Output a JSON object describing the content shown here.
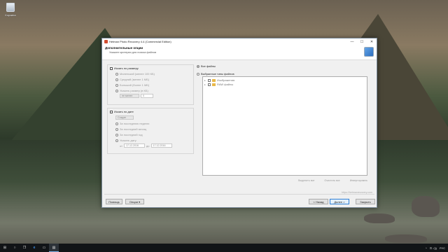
{
  "desktop": {
    "icon_label": "Корзина"
  },
  "window": {
    "title": "Hetman Photo Recovery 4.4 (Commercial Edition)",
    "controls": {
      "minimize": "—",
      "maximize": "☐",
      "close": "✕"
    },
    "header": {
      "title": "Дополнительные опции",
      "subtitle": "Укажите критерии для поиска файлов"
    },
    "size_group": {
      "label": "Искать по размеру",
      "options": [
        "Маленький (менее 100 КБ)",
        "Средний (менее 1 МБ)",
        "Больший (более 1 МБ)"
      ],
      "custom_label": "Указать размер (в КБ)",
      "mode_value": "не менее",
      "size_value": "0"
    },
    "date_group": {
      "label": "Искать по дате",
      "type_value": "Создан",
      "options": [
        "За последнюю неделю",
        "За последний месяц",
        "За последний год"
      ],
      "custom_label": "Указать дату",
      "from_label": "от",
      "from_value": "17.12.2016",
      "to_label": "до",
      "to_value": "17.12.2016"
    },
    "file_filter": {
      "all_files": "Все файлы",
      "selected_types": "Выбранные типы файлов",
      "tree": [
        "Изображения",
        "RAW файлы"
      ],
      "select_all": "Выделить все",
      "clear_all": "Очистить все",
      "invert": "Инвертировать"
    },
    "url": "https://hetmanrecovery.com",
    "footer": {
      "help": "Помощь",
      "options": "Опции ▾",
      "back": "< Назад",
      "next": "Далее >",
      "close": "Закрыть"
    }
  },
  "taskbar": {
    "start": "⊞",
    "search": "○",
    "task_view": "❐",
    "apps": [
      "e",
      "▭",
      "▤"
    ],
    "tray_chevron": "^",
    "tray_icons": "⊡ ◁))",
    "lang": "РУС"
  }
}
